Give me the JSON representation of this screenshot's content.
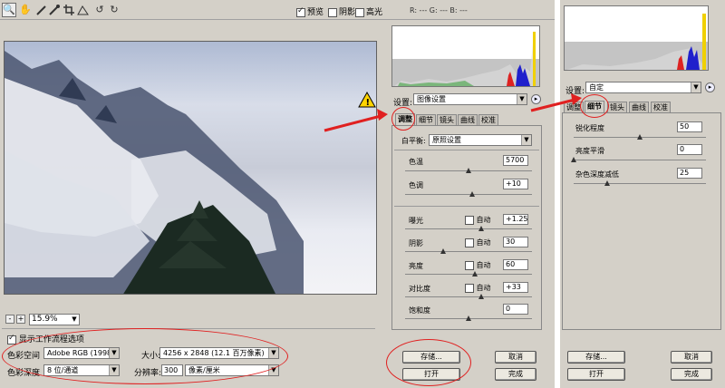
{
  "toolbar": {
    "preview_label": "预览",
    "shadow_label": "阴影",
    "highlight_label": "高光",
    "rgb_readout": "R: ---  G: ---  B: ---"
  },
  "zoom": {
    "minus": "-",
    "plus": "+",
    "value": "15.9%"
  },
  "workflow": {
    "show_label": "显示工作流程选项",
    "color_space_label": "色彩空间",
    "color_space_value": "Adobe RGB (1998)",
    "depth_label": "色彩深度",
    "depth_value": "8 位/通道",
    "size_label": "大小",
    "size_value": "4256 x 2848  (12.1 百万像素)",
    "resolution_label": "分辨率",
    "resolution_value": "300",
    "resolution_unit": "像素/厘米"
  },
  "main_panel": {
    "settings_label": "设置:",
    "settings_value": "图像设置",
    "tabs": [
      "调整",
      "细节",
      "镜头",
      "曲线",
      "校准"
    ],
    "white_balance_label": "白平衡:",
    "white_balance_value": "原照设置",
    "auto_label": "自动",
    "controls": [
      {
        "label": "色温",
        "value": "5700",
        "level": 0.5
      },
      {
        "label": "色调",
        "value": "+10",
        "level": 0.53
      },
      {
        "label": "曝光",
        "value": "+1.25",
        "level": 0.6
      },
      {
        "label": "阴影",
        "value": "30",
        "level": 0.3
      },
      {
        "label": "亮度",
        "value": "60",
        "level": 0.55
      },
      {
        "label": "对比度",
        "value": "+33",
        "level": 0.6
      },
      {
        "label": "饱和度",
        "value": "0",
        "level": 0.5
      }
    ],
    "save_button": "存储...",
    "open_button": "打开",
    "cancel_button": "取消",
    "done_button": "完成"
  },
  "side_panel": {
    "settings_label": "设置:",
    "settings_value": "自定",
    "tabs": [
      "调整",
      "细节",
      "镜头",
      "曲线",
      "校准"
    ],
    "controls": [
      {
        "label": "锐化程度",
        "value": "50",
        "level": 0.5
      },
      {
        "label": "亮度平滑",
        "value": "0",
        "level": 0.0
      },
      {
        "label": "杂色深度减低",
        "value": "25",
        "level": 0.25
      }
    ],
    "save_button": "存储...",
    "open_button": "打开",
    "cancel_button": "取消",
    "done_button": "完成"
  },
  "colors": {
    "annotation_red": "#e02020",
    "panel_bg": "#d4d0c8"
  },
  "icons": [
    "zoom-icon",
    "hand-icon",
    "eyedropper-icon",
    "color-sampler-icon",
    "crop-icon",
    "straighten-icon",
    "rotate-left-icon",
    "rotate-right-icon",
    "warning-icon"
  ]
}
